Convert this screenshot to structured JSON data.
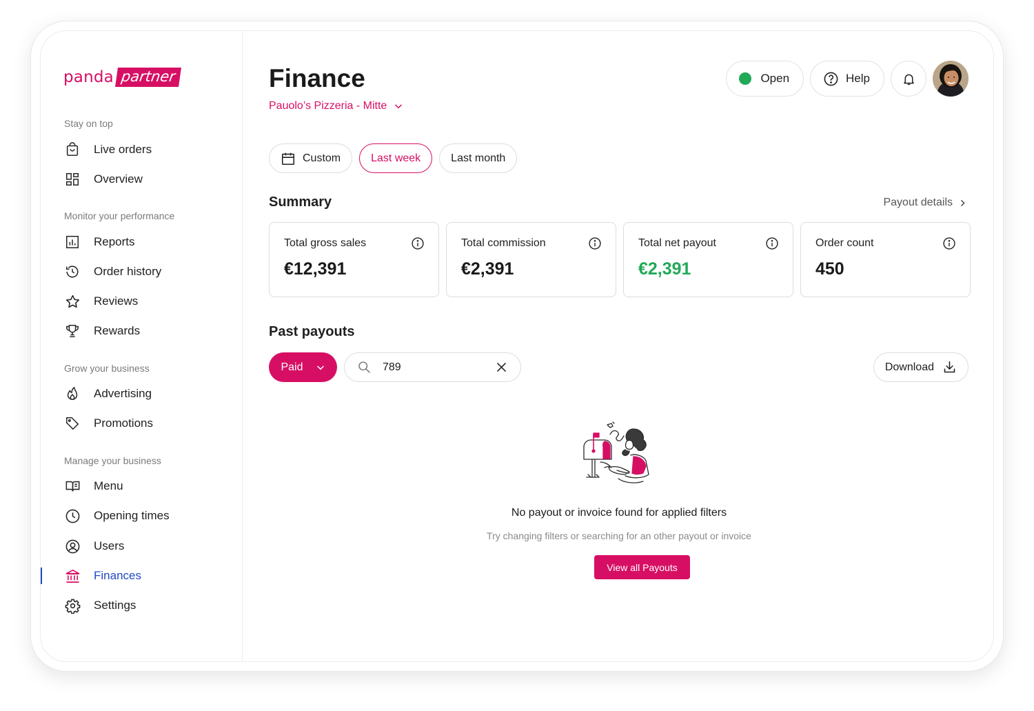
{
  "brand": {
    "name_part1": "panda",
    "name_part2": "partner",
    "accent": "#d70f64"
  },
  "sidebar": {
    "sections": [
      {
        "title": "Stay on top"
      },
      {
        "title": "Monitor your performance"
      },
      {
        "title": "Grow your business"
      },
      {
        "title": "Manage your business"
      }
    ],
    "items": [
      {
        "label": "Live orders",
        "icon": "shopping-bag-icon"
      },
      {
        "label": "Overview",
        "icon": "grid-icon"
      },
      {
        "label": "Reports",
        "icon": "bar-chart-icon"
      },
      {
        "label": "Order history",
        "icon": "history-icon"
      },
      {
        "label": "Reviews",
        "icon": "star-icon"
      },
      {
        "label": "Rewards",
        "icon": "trophy-icon"
      },
      {
        "label": "Advertising",
        "icon": "flame-icon"
      },
      {
        "label": "Promotions",
        "icon": "tag-icon"
      },
      {
        "label": "Menu",
        "icon": "book-icon"
      },
      {
        "label": "Opening times",
        "icon": "clock-icon"
      },
      {
        "label": "Users",
        "icon": "user-circle-icon"
      },
      {
        "label": "Finances",
        "icon": "bank-icon",
        "active": true
      },
      {
        "label": "Settings",
        "icon": "gear-icon"
      }
    ]
  },
  "header": {
    "title": "Finance",
    "store": "Pauolo’s Pizzeria - Mitte",
    "status_label": "Open",
    "status_color": "#21a957",
    "help_label": "Help"
  },
  "filters": {
    "chips": [
      {
        "label": "Custom",
        "icon": "calendar-icon"
      },
      {
        "label": "Last week",
        "active": true
      },
      {
        "label": "Last month"
      }
    ]
  },
  "summary": {
    "title": "Summary",
    "payout_details": "Payout details",
    "cards": [
      {
        "label": "Total gross sales",
        "value": "€12,391"
      },
      {
        "label": "Total commission",
        "value": "€2,391"
      },
      {
        "label": "Total net payout",
        "value": "€2,391",
        "color": "#21a957"
      },
      {
        "label": "Order count",
        "value": "450"
      }
    ]
  },
  "payouts": {
    "title": "Past payouts",
    "status_filter": "Paid",
    "search_value": "789",
    "download_label": "Download",
    "empty_title": "No payout or invoice found for applied filters",
    "empty_subtitle": "Try changing filters or searching for an other payout or invoice",
    "view_all_label": "View all Payouts"
  }
}
